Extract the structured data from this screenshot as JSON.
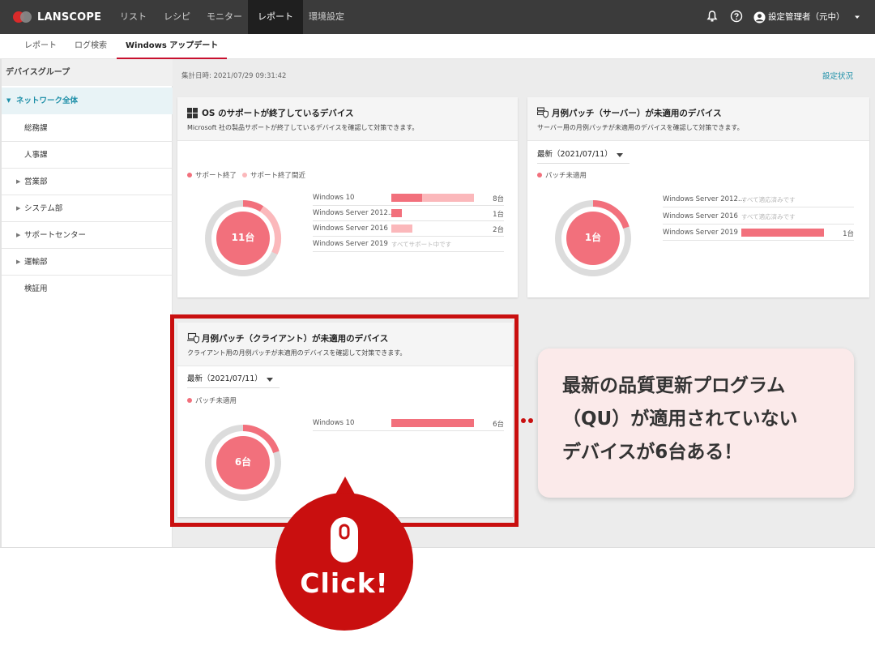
{
  "app": {
    "logo_text": "LANSCOPE"
  },
  "topnav": {
    "items": [
      "リスト",
      "レシピ",
      "モニター",
      "レポート",
      "環境設定"
    ],
    "active": "レポート",
    "user": "設定管理者（元中）"
  },
  "subtabs": {
    "items": [
      "レポート",
      "ログ検索",
      "Windows アップデート"
    ],
    "active": "Windows アップデート"
  },
  "sidebar": {
    "heading": "デバイスグループ",
    "items": [
      {
        "label": "ネットワーク全体",
        "active": true,
        "expandable": true
      },
      {
        "label": "総務課"
      },
      {
        "label": "人事課"
      },
      {
        "label": "営業部",
        "expandable": true
      },
      {
        "label": "システム部",
        "expandable": true
      },
      {
        "label": "サポートセンター",
        "expandable": true
      },
      {
        "label": "運輸部",
        "expandable": true
      },
      {
        "label": "検証用"
      }
    ]
  },
  "main": {
    "aggregated": "集計日時: 2021/07/29 09:31:42",
    "settings_link": "設定状況"
  },
  "cards": {
    "os": {
      "title": "OS のサポートが終了しているデバイス",
      "subtitle": "Microsoft 社の製品サポートが終了しているデバイスを確認して対策できます。",
      "legend": [
        "サポート終了",
        "サポート終了間近"
      ],
      "donut_label": "11台",
      "donut_fractions": {
        "ended": 0.09,
        "nearly": 0.23
      },
      "rows": [
        {
          "name": "Windows 10",
          "count": "8台",
          "ended": 0.375,
          "nearly": 0.625
        },
        {
          "name": "Windows Server 2012...",
          "count": "1台",
          "ended": 1.0,
          "nearly": 0
        },
        {
          "name": "Windows Server 2016",
          "count": "2台",
          "ended": 0,
          "nearly": 1.0
        },
        {
          "name": "Windows Server 2019",
          "count": "",
          "note": "すべてサポート中です"
        }
      ]
    },
    "server": {
      "title": "月例パッチ（サーバー）が未適用のデバイス",
      "subtitle": "サーバー用の月例パッチが未適用のデバイスを確認して対策できます。",
      "dropdown": "最新（2021/07/11）",
      "legend": [
        "パッチ未適用"
      ],
      "donut_label": "1台",
      "donut_fraction": 0.2,
      "rows": [
        {
          "name": "Windows Server 2012...",
          "note": "すべて適応済みです",
          "count": ""
        },
        {
          "name": "Windows Server 2016",
          "note": "すべて適応済みです",
          "count": ""
        },
        {
          "name": "Windows Server 2019",
          "count": "1台",
          "fill": 1.0
        }
      ]
    },
    "client": {
      "title": "月例パッチ（クライアント）が未適用のデバイス",
      "subtitle": "クライアント用の月例パッチが未適用のデバイスを確認して対策できます。",
      "dropdown": "最新（2021/07/11）",
      "legend": [
        "パッチ未適用"
      ],
      "donut_label": "6台",
      "donut_fraction": 0.2,
      "rows": [
        {
          "name": "Windows 10",
          "count": "6台",
          "fill": 1.0
        }
      ]
    }
  },
  "callout": {
    "text": "最新の品質更新プログラム\n（QU）が適用されていない\nデバイスが6台ある！"
  },
  "click_badge": {
    "text": "Click!"
  },
  "colors": {
    "topbar": "#3b3b3b",
    "accent_red": "#c90f0f",
    "pink_strong": "#f2707c",
    "pink_light": "#fbb8bb",
    "ring_gray": "#dcdcdc",
    "link": "#1d8fa8"
  }
}
